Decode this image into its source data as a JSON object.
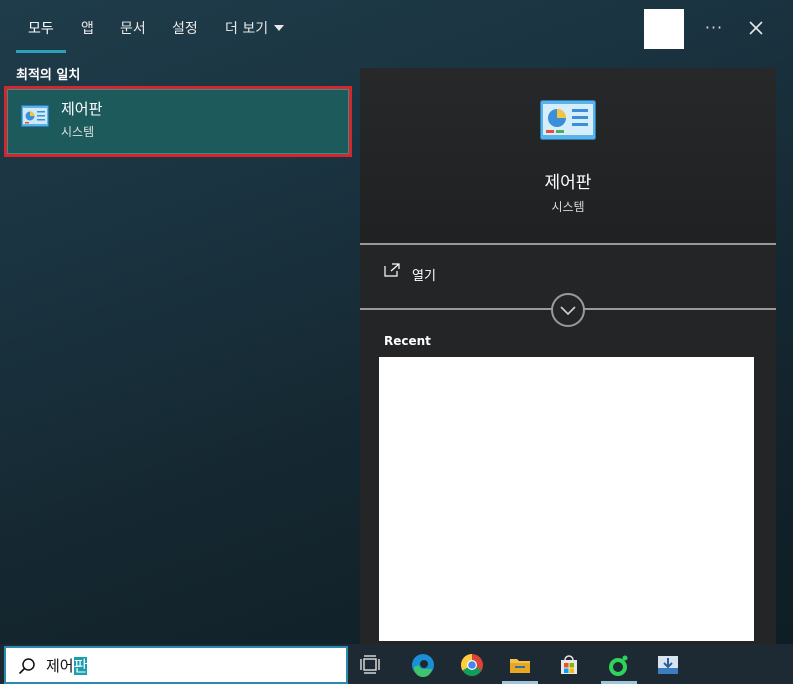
{
  "tabs": [
    {
      "label": "모두",
      "active": true
    },
    {
      "label": "앱",
      "active": false
    },
    {
      "label": "문서",
      "active": false
    },
    {
      "label": "설정",
      "active": false
    },
    {
      "label": "더 보기",
      "active": false
    }
  ],
  "more_options_label": "···",
  "best_match": {
    "section_label": "최적의 일치",
    "title": "제어판",
    "subtitle": "시스템",
    "icon": "control-panel-icon"
  },
  "preview": {
    "title": "제어판",
    "subtitle": "시스템",
    "open_label": "열기",
    "recent_label": "Recent"
  },
  "search": {
    "query_prefix": "제어",
    "query_highlight": "판",
    "icon": "search-icon"
  },
  "taskbar_icons": [
    "task-view-icon",
    "edge-icon",
    "chrome-icon",
    "file-explorer-icon",
    "microsoft-store-icon",
    "app-green-icon",
    "download-app-icon"
  ],
  "colors": {
    "accent": "#2aa3b8",
    "selection_border": "#d4262c",
    "selection_bg": "#1c5a5c"
  }
}
